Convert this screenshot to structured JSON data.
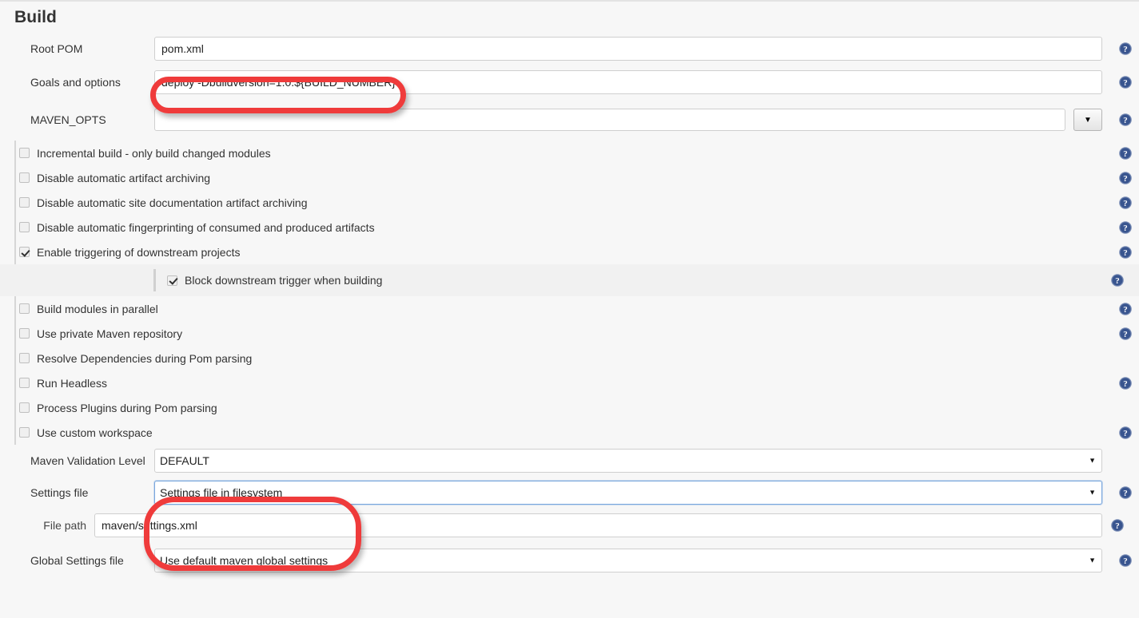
{
  "section": {
    "title": "Build"
  },
  "fields": {
    "root_pom": {
      "label": "Root POM",
      "value": "pom.xml",
      "placeholder": ""
    },
    "goals": {
      "label": "Goals and options",
      "value": "deploy -Dbuildversion=1.0.${BUILD_NUMBER}",
      "placeholder": ""
    },
    "maven_opts": {
      "label": "MAVEN_OPTS",
      "value": "",
      "placeholder": "",
      "dropdown_glyph": "▼"
    },
    "validation_level": {
      "label": "Maven Validation Level",
      "value": "DEFAULT",
      "options": [
        "DEFAULT"
      ]
    },
    "settings_file": {
      "label": "Settings file",
      "value": "Settings file in filesystem",
      "options": [
        "Settings file in filesystem"
      ]
    },
    "file_path": {
      "label": "File path",
      "value": "maven/settings.xml",
      "placeholder": ""
    },
    "global_settings_file": {
      "label": "Global Settings file",
      "value": "Use default maven global settings",
      "options": [
        "Use default maven global settings"
      ]
    }
  },
  "checkboxes_group_one": [
    {
      "label": "Incremental build - only build changed modules",
      "checked": false
    },
    {
      "label": "Disable automatic artifact archiving",
      "checked": false
    },
    {
      "label": "Disable automatic site documentation artifact archiving",
      "checked": false
    },
    {
      "label": "Disable automatic fingerprinting of consumed and produced artifacts",
      "checked": false
    },
    {
      "label": "Enable triggering of downstream projects",
      "checked": true
    }
  ],
  "nested_checkbox": {
    "label": "Block downstream trigger when building",
    "checked": true
  },
  "checkboxes_group_two": [
    {
      "label": "Build modules in parallel",
      "checked": false
    },
    {
      "label": "Use private Maven repository",
      "checked": false
    },
    {
      "label": "Resolve Dependencies during Pom parsing",
      "checked": false
    },
    {
      "label": "Run Headless",
      "checked": false
    },
    {
      "label": "Process Plugins during Pom parsing",
      "checked": false
    },
    {
      "label": "Use custom workspace",
      "checked": false
    }
  ],
  "icons": {
    "help": "help-icon",
    "caret_down": "▼"
  },
  "colors": {
    "annotation": "#ef3b3b",
    "help_icon": "#39558f",
    "page_background": "#f7f7f7",
    "nested_row_background": "#f1f1f1",
    "focus_border": "#7aa7dd"
  }
}
